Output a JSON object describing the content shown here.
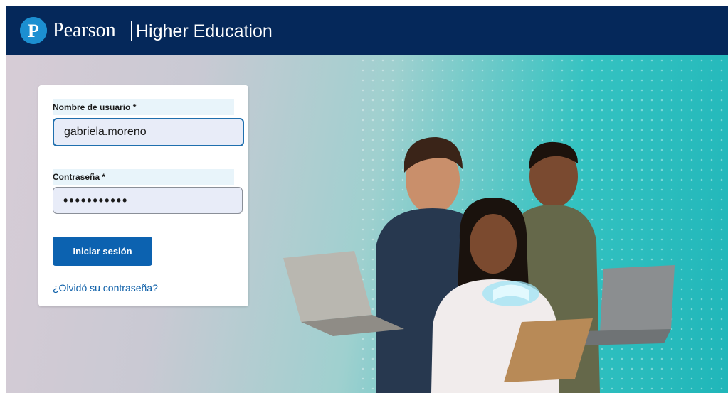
{
  "header": {
    "brand": "Pearson",
    "product": "Higher Education",
    "logo_letter": "P"
  },
  "login": {
    "username_label": "Nombre de usuario *",
    "username_value": "gabriela.moreno",
    "password_label": "Contraseña *",
    "password_value": "•••••••••••",
    "submit_label": "Iniciar sesión",
    "forgot_link": "¿Olvidó su contraseña?"
  },
  "colors": {
    "header_bg": "#05285a",
    "logo_blue": "#1c8fd1",
    "button_blue": "#0c62b0",
    "link_blue": "#0d5fa8"
  },
  "hero": {
    "image": "students-with-laptops-and-tablet"
  }
}
